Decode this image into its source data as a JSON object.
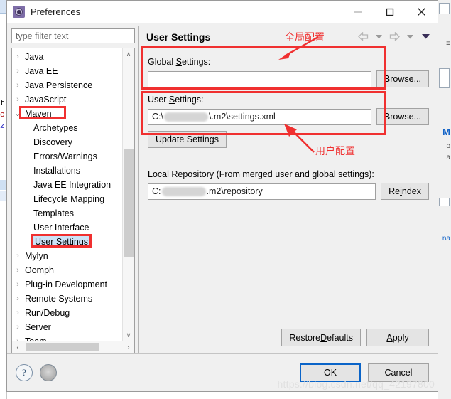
{
  "window": {
    "title": "Preferences",
    "icon": "preferences-gear-icon",
    "minimize_label": "—",
    "maximize_label": "□",
    "close_label": "✕"
  },
  "sidebar": {
    "filter_placeholder": "type filter text",
    "items": [
      {
        "label": "Java",
        "state": "collapsed",
        "level": 0
      },
      {
        "label": "Java EE",
        "state": "collapsed",
        "level": 0
      },
      {
        "label": "Java Persistence",
        "state": "collapsed",
        "level": 0
      },
      {
        "label": "JavaScript",
        "state": "collapsed",
        "level": 0
      },
      {
        "label": "Maven",
        "state": "expanded",
        "level": 0,
        "highlighted": true
      },
      {
        "label": "Archetypes",
        "state": "leaf",
        "level": 1
      },
      {
        "label": "Discovery",
        "state": "leaf",
        "level": 1
      },
      {
        "label": "Errors/Warnings",
        "state": "leaf",
        "level": 1
      },
      {
        "label": "Installations",
        "state": "leaf",
        "level": 1
      },
      {
        "label": "Java EE Integration",
        "state": "leaf",
        "level": 1
      },
      {
        "label": "Lifecycle Mapping",
        "state": "leaf",
        "level": 1
      },
      {
        "label": "Templates",
        "state": "leaf",
        "level": 1
      },
      {
        "label": "User Interface",
        "state": "leaf",
        "level": 1
      },
      {
        "label": "User Settings",
        "state": "leaf",
        "level": 1,
        "selected": true,
        "highlighted": true
      },
      {
        "label": "Mylyn",
        "state": "collapsed",
        "level": 0
      },
      {
        "label": "Oomph",
        "state": "collapsed",
        "level": 0
      },
      {
        "label": "Plug-in Development",
        "state": "collapsed",
        "level": 0
      },
      {
        "label": "Remote Systems",
        "state": "collapsed",
        "level": 0
      },
      {
        "label": "Run/Debug",
        "state": "collapsed",
        "level": 0
      },
      {
        "label": "Server",
        "state": "collapsed",
        "level": 0
      },
      {
        "label": "Team",
        "state": "collapsed",
        "level": 0
      }
    ],
    "collapsed_glyph": "›",
    "expanded_glyph": "⌄",
    "scroll_up_glyph": "∧",
    "scroll_down_glyph": "∨",
    "scroll_left_glyph": "‹",
    "scroll_right_glyph": "›"
  },
  "page": {
    "title": "User Settings",
    "nav": {
      "back_icon": "back-arrow-icon",
      "back_menu_icon": "chevron-down-icon",
      "forward_icon": "forward-arrow-icon",
      "forward_menu_icon": "chevron-down-icon",
      "more_icon": "chevron-down-filled-icon"
    },
    "global_settings": {
      "label_pre": "Global ",
      "label_mnemonic": "S",
      "label_post": "ettings:",
      "value": "",
      "browse_label": "Browse..."
    },
    "user_settings": {
      "label_pre": "User ",
      "label_mnemonic": "S",
      "label_post": "ettings:",
      "value_prefix": "C:\\",
      "value_suffix": "\\.m2\\settings.xml",
      "browse_label": "Browse...",
      "update_label": "Update Settings"
    },
    "local_repository": {
      "label": "Local Repository (From merged user and global settings):",
      "value_prefix": "C:",
      "value_suffix": ".m2\\repository",
      "reindex_pre": "Re",
      "reindex_mnemonic": "i",
      "reindex_post": "ndex"
    },
    "restore_defaults": {
      "pre": "Restore ",
      "mnemonic": "D",
      "post": "efaults"
    },
    "apply": {
      "pre": "",
      "mnemonic": "A",
      "post": "pply"
    }
  },
  "annotations": {
    "global_config_text": "全局配置",
    "user_config_text": "用户配置",
    "accent_color": "#f03030"
  },
  "footer": {
    "help_icon": "help-question-icon",
    "help_glyph": "?",
    "restore_icon": "restore-circle-icon",
    "ok_label": "OK",
    "cancel_label": "Cancel"
  },
  "watermark": {
    "text": "https://blog.csdn.net/qq_42197800"
  },
  "background": {
    "left_code_lines": [
      "t",
      "c",
      "z"
    ],
    "right_items": [
      "a",
      "o",
      "a",
      "na"
    ],
    "right_blue": "M"
  }
}
